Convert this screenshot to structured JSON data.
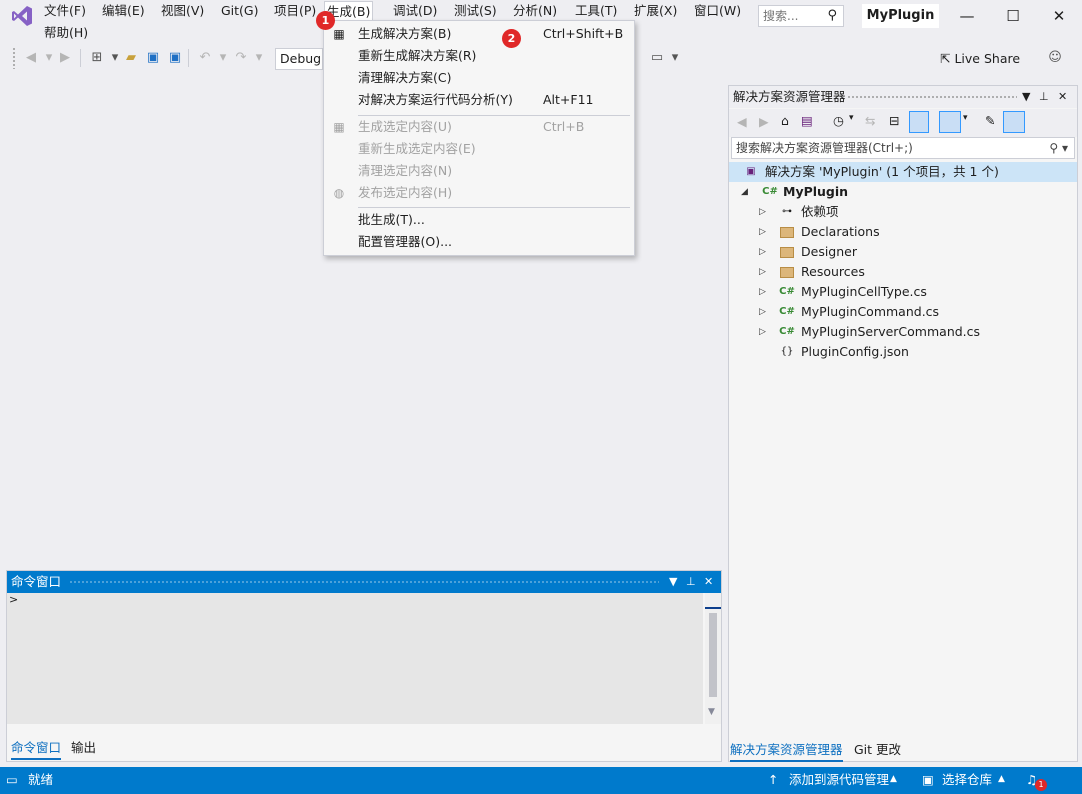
{
  "menu": {
    "items": [
      "文件(F)",
      "编辑(E)",
      "视图(V)",
      "Git(G)",
      "项目(P)",
      "生成(B)",
      "调试(D)",
      "测试(S)",
      "分析(N)",
      "工具(T)",
      "扩展(X)",
      "窗口(W)",
      "帮助(H)"
    ],
    "search_placeholder": "搜索...",
    "project_name": "MyPlugin"
  },
  "toolbar": {
    "config": "Debug",
    "live_share": "Live Share"
  },
  "build_menu": {
    "items": [
      {
        "label": "生成解决方案(B)",
        "shortcut": "Ctrl+Shift+B",
        "enabled": true
      },
      {
        "label": "重新生成解决方案(R)",
        "shortcut": "",
        "enabled": true
      },
      {
        "label": "清理解决方案(C)",
        "shortcut": "",
        "enabled": true
      },
      {
        "label": "对解决方案运行代码分析(Y)",
        "shortcut": "Alt+F11",
        "enabled": true
      },
      {
        "label": "生成选定内容(U)",
        "shortcut": "Ctrl+B",
        "enabled": false
      },
      {
        "label": "重新生成选定内容(E)",
        "shortcut": "",
        "enabled": false
      },
      {
        "label": "清理选定内容(N)",
        "shortcut": "",
        "enabled": false
      },
      {
        "label": "发布选定内容(H)",
        "shortcut": "",
        "enabled": false
      },
      {
        "label": "批生成(T)...",
        "shortcut": "",
        "enabled": true
      },
      {
        "label": "配置管理器(O)...",
        "shortcut": "",
        "enabled": true
      }
    ]
  },
  "annotations": {
    "step1": "1",
    "step2": "2"
  },
  "solution_explorer": {
    "title": "解决方案资源管理器",
    "search_placeholder": "搜索解决方案资源管理器(Ctrl+;)",
    "solution_label": "解决方案 'MyPlugin' (1 个项目，共 1 个)",
    "project": "MyPlugin",
    "items": [
      "依赖项",
      "Declarations",
      "Designer",
      "Resources",
      "MyPluginCellType.cs",
      "MyPluginCommand.cs",
      "MyPluginServerCommand.cs",
      "PluginConfig.json"
    ],
    "tabs": [
      "解决方案资源管理器",
      "Git 更改"
    ]
  },
  "command_window": {
    "title": "命令窗口",
    "prompt": ">",
    "tabs": [
      "命令窗口",
      "输出"
    ]
  },
  "statusbar": {
    "ready": "就绪",
    "add_source": "添加到源代码管理",
    "select_repo": "选择仓库",
    "notification_count": "1"
  },
  "colors": {
    "accent": "#007acc",
    "badge": "#e02828",
    "vs_purple": "#68217a"
  }
}
